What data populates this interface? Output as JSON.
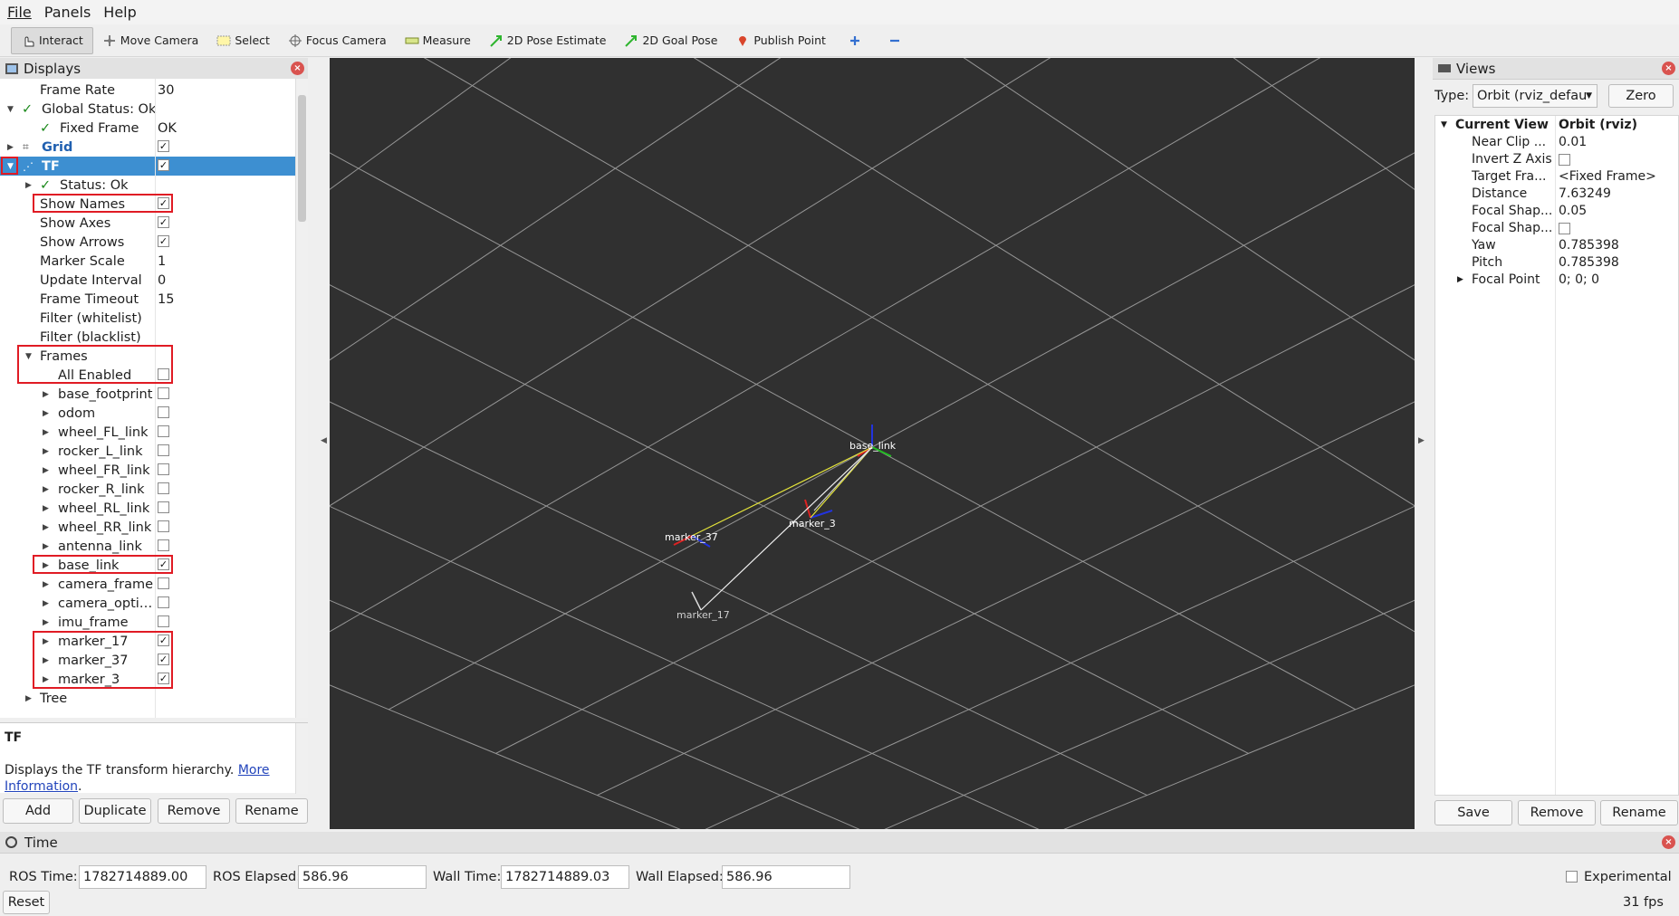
{
  "menu": [
    "File",
    "Panels",
    "Help"
  ],
  "toolbar": {
    "interact": "Interact",
    "move_camera": "Move Camera",
    "select": "Select",
    "focus_camera": "Focus Camera",
    "measure": "Measure",
    "pose_estimate": "2D Pose Estimate",
    "goal_pose": "2D Goal Pose",
    "publish_point": "Publish Point"
  },
  "displays": {
    "title": "Displays",
    "rows": [
      {
        "name": "Frame Rate",
        "value": "30"
      },
      {
        "name": "Global Status: Ok"
      },
      {
        "name": "Fixed Frame",
        "value": "OK"
      },
      {
        "name": "Grid"
      },
      {
        "name": "TF"
      },
      {
        "name": "Status: Ok"
      },
      {
        "name": "Show Names"
      },
      {
        "name": "Show Axes"
      },
      {
        "name": "Show Arrows"
      },
      {
        "name": "Marker Scale",
        "value": "1"
      },
      {
        "name": "Update Interval",
        "value": "0"
      },
      {
        "name": "Frame Timeout",
        "value": "15"
      },
      {
        "name": "Filter (whitelist)"
      },
      {
        "name": "Filter (blacklist)"
      },
      {
        "name": "Frames"
      },
      {
        "name": "All Enabled"
      },
      {
        "name": "base_footprint"
      },
      {
        "name": "odom"
      },
      {
        "name": "wheel_FL_link"
      },
      {
        "name": "rocker_L_link"
      },
      {
        "name": "wheel_FR_link"
      },
      {
        "name": "rocker_R_link"
      },
      {
        "name": "wheel_RL_link"
      },
      {
        "name": "wheel_RR_link"
      },
      {
        "name": "antenna_link"
      },
      {
        "name": "base_link"
      },
      {
        "name": "camera_frame"
      },
      {
        "name": "camera_opti…"
      },
      {
        "name": "imu_frame"
      },
      {
        "name": "marker_17"
      },
      {
        "name": "marker_37"
      },
      {
        "name": "marker_3"
      },
      {
        "name": "Tree"
      }
    ],
    "desc_title": "TF",
    "desc_text": "Displays the TF transform hierarchy. ",
    "desc_link1": "More",
    "desc_link2": "Information",
    "desc_period": ".",
    "buttons": [
      "Add",
      "Duplicate",
      "Remove",
      "Rename"
    ]
  },
  "viewport": {
    "labels": [
      "base_link",
      "marker_37",
      "marker_3",
      "marker_17"
    ]
  },
  "views": {
    "title": "Views",
    "type_label": "Type:",
    "type_value": "Orbit (rviz_defau",
    "zero": "Zero",
    "header_name": "Current View",
    "header_value": "Orbit (rviz)",
    "rows": [
      {
        "name": "Near Clip ...",
        "value": "0.01"
      },
      {
        "name": "Invert Z Axis",
        "value": ""
      },
      {
        "name": "Target Fra...",
        "value": "<Fixed Frame>"
      },
      {
        "name": "Distance",
        "value": "7.63249"
      },
      {
        "name": "Focal Shap...",
        "value": "0.05"
      },
      {
        "name": "Focal Shap...",
        "value": ""
      },
      {
        "name": "Yaw",
        "value": "0.785398"
      },
      {
        "name": "Pitch",
        "value": "0.785398"
      },
      {
        "name": "Focal Point",
        "value": "0; 0; 0"
      }
    ],
    "buttons": [
      "Save",
      "Remove",
      "Rename"
    ]
  },
  "time": {
    "title": "Time",
    "ros_time_label": "ROS Time:",
    "ros_time": "1782714889.00",
    "ros_elapsed_label": "ROS Elapsed:",
    "ros_elapsed": "586.96",
    "wall_time_label": "Wall Time:",
    "wall_time": "1782714889.03",
    "wall_elapsed_label": "Wall Elapsed:",
    "wall_elapsed": "586.96",
    "experimental": "Experimental",
    "reset": "Reset",
    "fps": "31 fps"
  },
  "colors": {
    "selection": "#3d8fd1",
    "highlight_box": "#e01b24",
    "viewport_bg": "#303030"
  }
}
